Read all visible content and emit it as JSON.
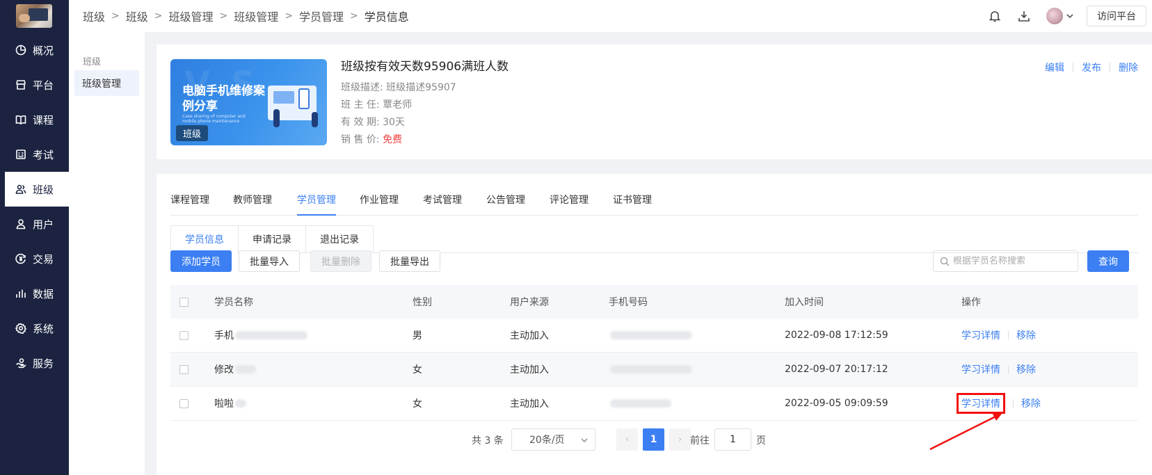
{
  "sidebar": {
    "items": [
      {
        "label": "概况",
        "icon": "pie-chart-icon"
      },
      {
        "label": "平台",
        "icon": "store-icon"
      },
      {
        "label": "课程",
        "icon": "book-icon"
      },
      {
        "label": "考试",
        "icon": "exam-icon"
      },
      {
        "label": "班级",
        "icon": "group-icon",
        "active": true
      },
      {
        "label": "用户",
        "icon": "user-icon"
      },
      {
        "label": "交易",
        "icon": "currency-icon"
      },
      {
        "label": "数据",
        "icon": "bar-chart-icon"
      },
      {
        "label": "系统",
        "icon": "gear-icon"
      },
      {
        "label": "服务",
        "icon": "service-icon"
      }
    ]
  },
  "breadcrumb": [
    "班级",
    "班级",
    "班级管理",
    "班级管理",
    "学员管理",
    "学员信息"
  ],
  "topbar": {
    "visit_label": "访问平台"
  },
  "subsidebar": {
    "group": "班级",
    "item": "班级管理"
  },
  "class_info": {
    "cover_title": "电脑手机维修案例分享",
    "cover_subtitle": "Case sharing of computer and mobile phone maintenance",
    "cover_badge": "班级",
    "title": "班级按有效天数95906满班人数",
    "desc_label": "班级描述:",
    "desc_value": "班级描述95907",
    "teacher_label": "班 主 任:",
    "teacher_value": "覃老师",
    "period_label": "有 效 期:",
    "period_value": "30天",
    "price_label": "销 售 价:",
    "price_value": "免费",
    "actions": [
      "编辑",
      "发布",
      "删除"
    ]
  },
  "tabs": [
    "课程管理",
    "教师管理",
    "学员管理",
    "作业管理",
    "考试管理",
    "公告管理",
    "评论管理",
    "证书管理"
  ],
  "active_tab": "学员管理",
  "subtabs": [
    "学员信息",
    "申请记录",
    "退出记录"
  ],
  "toolbar": {
    "add": "添加学员",
    "import": "批量导入",
    "delete": "批量删除",
    "export": "批量导出",
    "search_placeholder": "根据学员名称搜索",
    "query": "查询"
  },
  "table": {
    "headers": [
      "学员名称",
      "性别",
      "用户来源",
      "手机号码",
      "加入时间",
      "操作"
    ],
    "rows": [
      {
        "name": "手机",
        "gender": "男",
        "source": "主动加入",
        "joined": "2022-09-08 17:12:59"
      },
      {
        "name": "修改",
        "gender": "女",
        "source": "主动加入",
        "joined": "2022-09-07 20:17:12"
      },
      {
        "name": "啦啦",
        "gender": "女",
        "source": "主动加入",
        "joined": "2022-09-05 09:09:59"
      }
    ],
    "op_detail": "学习详情",
    "op_remove": "移除"
  },
  "pagination": {
    "total": "共 3 条",
    "page_size": "20条/页",
    "current_page": "1",
    "goto_label": "前往",
    "goto_value": "1",
    "page_label": "页"
  },
  "colors": {
    "primary": "#3b7ff3",
    "sidebar": "#1b2340",
    "danger": "#f24040",
    "highlight": "#f30f0f"
  }
}
